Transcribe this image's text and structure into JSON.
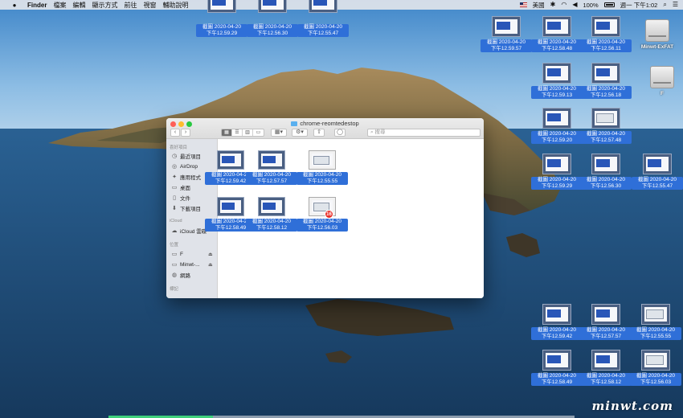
{
  "menubar": {
    "app": "Finder",
    "items": [
      "檔案",
      "編輯",
      "顯示方式",
      "前往",
      "視窗",
      "輔助說明"
    ],
    "input_source": "美國",
    "battery": "100%",
    "clock": "週一 下午1:02"
  },
  "desktop": {
    "top_icons": [
      {
        "date": "截圖 2020-04-20",
        "time": "下午12.59.29"
      },
      {
        "date": "截圖 2020-04-20",
        "time": "下午12.56.30"
      },
      {
        "date": "截圖 2020-04-20",
        "time": "下午12.55.47"
      }
    ],
    "right_icons": [
      {
        "date": "截圖 2020-04-20",
        "time": "下午12.59.57"
      },
      {
        "date": "截圖 2020-04-20",
        "time": "下午12.58.48"
      },
      {
        "date": "截圖 2020-04-20",
        "time": "下午12.56.11"
      },
      {
        "date": "截圖 2020-04-20",
        "time": "下午12.59.13"
      },
      {
        "date": "截圖 2020-04-20",
        "time": "下午12.56.18"
      },
      {
        "date": "截圖 2020-04-20",
        "time": "下午12.59.20"
      },
      {
        "date": "截圖 2020-04-20",
        "time": "下午12.57.48"
      },
      {
        "date": "截圖 2020-04-20",
        "time": "下午12.59.29"
      },
      {
        "date": "截圖 2020-04-20",
        "time": "下午12.56.30"
      },
      {
        "date": "截圖 2020-04-20",
        "time": "下午12.55.47"
      }
    ],
    "bottom_icons": [
      {
        "date": "截圖 2020-04-20",
        "time": "下午12.59.42"
      },
      {
        "date": "截圖 2020-04-20",
        "time": "下午12.57.57"
      },
      {
        "date": "截圖 2020-04-20",
        "time": "下午12.55.55"
      },
      {
        "date": "截圖 2020-04-20",
        "time": "下午12.58.49"
      },
      {
        "date": "截圖 2020-04-20",
        "time": "下午12.58.12"
      },
      {
        "date": "截圖 2020-04-20",
        "time": "下午12.56.03"
      }
    ],
    "drives": [
      {
        "label": "Minwt-ExFAT"
      },
      {
        "label": "F"
      }
    ]
  },
  "finder": {
    "title": "chrome-reomtedestop",
    "search_placeholder": "搜尋",
    "sidebar": {
      "favorites_header": "喜好項目",
      "favorites": [
        "最近項目",
        "AirDrop",
        "應用程式",
        "桌面",
        "文件",
        "下載項目"
      ],
      "icloud_header": "iCloud",
      "icloud_items": [
        "iCloud 雲碟"
      ],
      "locations_header": "位置",
      "locations": [
        "F",
        "Minwt-...",
        "網路"
      ],
      "tags_header": "標記"
    },
    "files": [
      {
        "date": "截圖 2020-04-20",
        "time": "下午12.59.42"
      },
      {
        "date": "截圖 2020-04-20",
        "time": "下午12.57.57"
      },
      {
        "date": "截圖 2020-04-20",
        "time": "下午12.55.55"
      },
      {
        "date": "截圖 2020-04-20",
        "time": "下午12.58.49"
      },
      {
        "date": "截圖 2020-04-20",
        "time": "下午12.58.12"
      },
      {
        "date": "截圖 2020-04-20",
        "time": "下午12.56.03"
      }
    ],
    "drag_count_badge": "16"
  },
  "watermark": "minwt.com"
}
